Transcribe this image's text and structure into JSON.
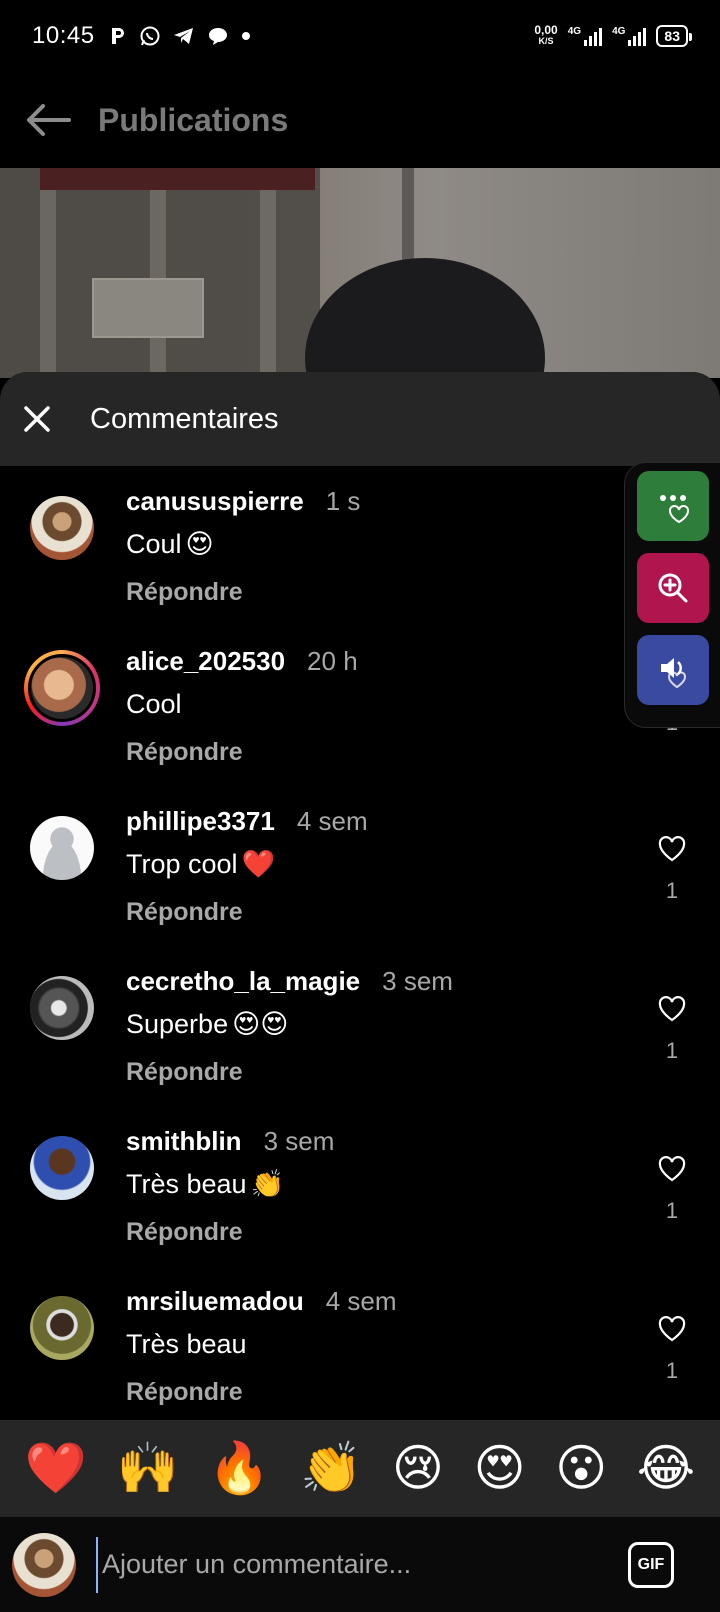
{
  "status_bar": {
    "time": "10:45",
    "left_icons": [
      "p-icon",
      "whatsapp-icon",
      "telegram-icon",
      "chat-bubble-icon",
      "dot-icon"
    ],
    "net_speed_value": "0,00",
    "net_speed_unit": "K/S",
    "sim1_label": "4G",
    "sim2_label": "4G",
    "battery": "83"
  },
  "header": {
    "title": "Publications"
  },
  "comments_sheet": {
    "title": "Commentaires",
    "reply_label": "Répondre",
    "items": [
      {
        "user": "canususpierre",
        "time": "1 s",
        "text": "Coul",
        "emoji": "😍",
        "likes": ""
      },
      {
        "user": "alice_202530",
        "time": "20 h",
        "text": "Cool",
        "emoji": "",
        "likes": "1"
      },
      {
        "user": "phillipe3371",
        "time": "4 sem",
        "text": "Trop cool",
        "emoji": "❤️",
        "likes": "1"
      },
      {
        "user": "cecretho_la_magie",
        "time": "3 sem",
        "text": "Superbe",
        "emoji": "😍😍",
        "likes": "1"
      },
      {
        "user": "smithblin",
        "time": "3 sem",
        "text": "Très beau",
        "emoji": "👏",
        "likes": "1"
      },
      {
        "user": "mrsiluemadou",
        "time": "4 sem",
        "text": "Très beau",
        "emoji": "",
        "likes": "1"
      }
    ]
  },
  "side_panel": {
    "buttons": [
      "dots-heart-icon",
      "zoom-in-icon",
      "sound-heart-icon"
    ],
    "colors": [
      "#2e7d3b",
      "#b0154e",
      "#3a4aa0"
    ]
  },
  "emoji_bar": [
    "❤️",
    "🙌",
    "🔥",
    "👏",
    "😢",
    "😍",
    "😮",
    "😂"
  ],
  "input": {
    "placeholder": "Ajouter un commentaire...",
    "gif_label": "GIF"
  }
}
